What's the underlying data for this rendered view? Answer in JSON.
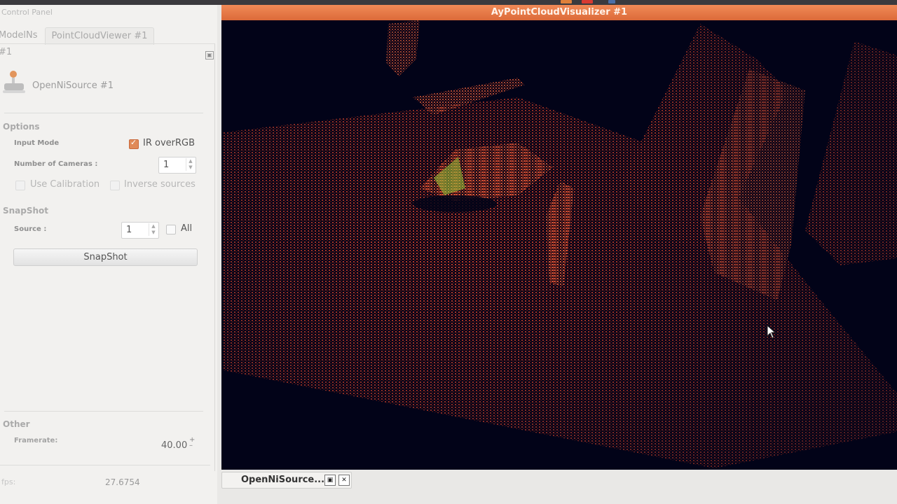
{
  "panel": {
    "title": "Control Panel",
    "tabs": [
      "ModelNs #1",
      "PointCloudViewer #1"
    ],
    "source_name": "OpenNiSource #1",
    "options": {
      "title": "Options",
      "input_mode_label": "Input Mode",
      "ir_over_rgb_label": "IR overRGB",
      "ir_over_rgb_checked": true,
      "num_cameras_label": "Number of Cameras :",
      "num_cameras_value": "1",
      "use_calibration_label": "Use Calibration",
      "use_calibration_enabled": false,
      "inverse_sources_label": "Inverse sources",
      "inverse_sources_enabled": false
    },
    "snapshot": {
      "title": "SnapShot",
      "source_label": "Source :",
      "source_value": "1",
      "all_label": "All",
      "all_checked": false,
      "button_label": "SnapShot"
    },
    "other": {
      "title": "Other",
      "framerate_label": "Framerate:",
      "framerate_value": "40.00"
    },
    "fps": {
      "label": "fps:",
      "value": "27.6754"
    }
  },
  "visualizer": {
    "title": "AyPointCloudVisualizer #1",
    "title_color": "#e5754a",
    "background_color": "#020318"
  },
  "dock": {
    "tab_label": "OpenNiSource..."
  },
  "icons": [
    "float-icon",
    "kinect-camera-icon",
    "cursor-icon",
    "restore-icon",
    "close-icon"
  ]
}
